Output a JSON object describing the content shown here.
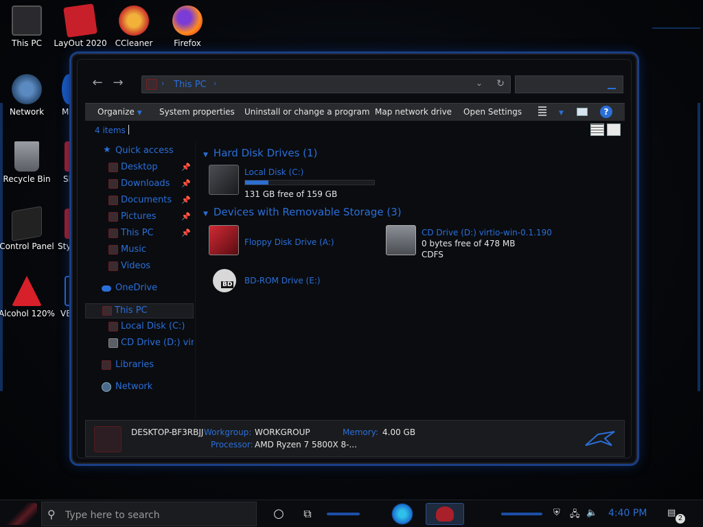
{
  "desktop": {
    "icons": [
      {
        "label": "This PC"
      },
      {
        "label": "LayOut 2020"
      },
      {
        "label": "CCleaner"
      },
      {
        "label": "Firefox"
      },
      {
        "label": "Network"
      },
      {
        "label": "Mi"
      },
      {
        "label": "Recycle Bin"
      },
      {
        "label": "Sk"
      },
      {
        "label": "Control Panel"
      },
      {
        "label": "Styl"
      },
      {
        "label": "Alcohol 120%"
      },
      {
        "label": "VE"
      }
    ]
  },
  "window": {
    "address": "This PC",
    "toolbar": {
      "organize": "Organize",
      "system_properties": "System properties",
      "uninstall": "Uninstall or change a program",
      "map_drive": "Map network drive",
      "open_settings": "Open Settings",
      "help": "?"
    },
    "status": {
      "items": "4 items"
    },
    "nav": {
      "quick_access": "Quick access",
      "items": [
        "Desktop",
        "Downloads",
        "Documents",
        "Pictures",
        "This PC",
        "Music",
        "Videos"
      ],
      "onedrive": "OneDrive",
      "this_pc": "This PC",
      "local_disk": "Local Disk (C:)",
      "cd_drive": "CD Drive (D:) virtic",
      "libraries": "Libraries",
      "network": "Network"
    },
    "groups": {
      "hdd": "Hard Disk Drives (1)",
      "removable": "Devices with Removable Storage (3)"
    },
    "drives": {
      "c": {
        "name": "Local Disk (C:)",
        "free": "131 GB free of 159 GB",
        "used_fraction": 0.18
      },
      "floppy": {
        "name": "Floppy Disk Drive (A:)"
      },
      "cd": {
        "name": "CD Drive (D:) virtio-win-0.1.190",
        "free": "0 bytes free of 478 MB",
        "fs": "CDFS"
      },
      "bd": {
        "name": "BD-ROM Drive (E:)",
        "badge": "BD"
      }
    },
    "details": {
      "computer": "DESKTOP-BF3RBJJ",
      "workgroup_label": "Workgroup:",
      "workgroup": "WORKGROUP",
      "memory_label": "Memory:",
      "memory": "4.00 GB",
      "processor_label": "Processor:",
      "processor": "AMD Ryzen 7 5800X 8-..."
    }
  },
  "taskbar": {
    "search_placeholder": "Type here to search",
    "time": "4:40 PM",
    "notifications": "2"
  },
  "colors": {
    "accent": "#2b6fd8",
    "brand_red": "#c0202e"
  }
}
